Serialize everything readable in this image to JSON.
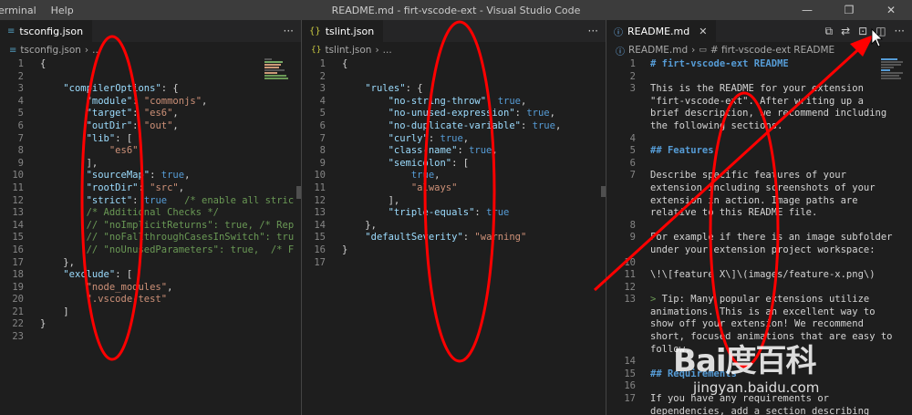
{
  "window": {
    "menu": [
      "erminal",
      "Help"
    ],
    "title": "README.md - firt-vscode-ext - Visual Studio Code",
    "controls": [
      "—",
      "❐",
      "✕"
    ]
  },
  "group1": {
    "tab": "tsconfig.json",
    "breadcrumb": [
      "tsconfig.json",
      "..."
    ],
    "more": "···",
    "lines": [
      {
        "n": "1",
        "t": "{"
      },
      {
        "n": "2",
        "t": ""
      },
      {
        "n": "3",
        "t": "    \"compilerOptions\": {"
      },
      {
        "n": "4",
        "t": "        \"module\": \"commonjs\","
      },
      {
        "n": "5",
        "t": "        \"target\": \"es6\","
      },
      {
        "n": "6",
        "t": "        \"outDir\": \"out\","
      },
      {
        "n": "7",
        "t": "        \"lib\": ["
      },
      {
        "n": "8",
        "t": "            \"es6\""
      },
      {
        "n": "9",
        "t": "        ],"
      },
      {
        "n": "10",
        "t": "        \"sourceMap\": true,"
      },
      {
        "n": "11",
        "t": "        \"rootDir\": \"src\","
      },
      {
        "n": "12",
        "t": "        \"strict\": true   /* enable all stric"
      },
      {
        "n": "13",
        "t": "        /* Additional Checks */"
      },
      {
        "n": "14",
        "t": "        // \"noImplicitReturns\": true, /* Rep"
      },
      {
        "n": "15",
        "t": "        // \"noFallthroughCasesInSwitch\": tru"
      },
      {
        "n": "16",
        "t": "        // \"noUnusedParameters\": true,  /* F"
      },
      {
        "n": "17",
        "t": "    },"
      },
      {
        "n": "18",
        "t": "    \"exclude\": ["
      },
      {
        "n": "19",
        "t": "        \"node_modules\","
      },
      {
        "n": "20",
        "t": "        \".vscode-test\""
      },
      {
        "n": "21",
        "t": "    ]"
      },
      {
        "n": "22",
        "t": "}"
      },
      {
        "n": "23",
        "t": ""
      }
    ]
  },
  "group2": {
    "tab": "tslint.json",
    "breadcrumb": [
      "tslint.json",
      "..."
    ],
    "more": "···",
    "lines": [
      {
        "n": "1",
        "t": "{"
      },
      {
        "n": "2",
        "t": ""
      },
      {
        "n": "3",
        "t": "    \"rules\": {"
      },
      {
        "n": "4",
        "t": "        \"no-string-throw\": true,"
      },
      {
        "n": "5",
        "t": "        \"no-unused-expression\": true,"
      },
      {
        "n": "6",
        "t": "        \"no-duplicate-variable\": true,"
      },
      {
        "n": "7",
        "t": "        \"curly\": true,"
      },
      {
        "n": "8",
        "t": "        \"class-name\": true,"
      },
      {
        "n": "9",
        "t": "        \"semicolon\": ["
      },
      {
        "n": "10",
        "t": "            true,"
      },
      {
        "n": "11",
        "t": "            \"always\""
      },
      {
        "n": "12",
        "t": "        ],"
      },
      {
        "n": "13",
        "t": "        \"triple-equals\": true"
      },
      {
        "n": "14",
        "t": "    },"
      },
      {
        "n": "15",
        "t": "    \"defaultSeverity\": \"warning\""
      },
      {
        "n": "16",
        "t": "}"
      },
      {
        "n": "17",
        "t": ""
      }
    ]
  },
  "group3": {
    "tab": "README.md",
    "breadcrumb": [
      "README.md",
      "# firt-vscode-ext README"
    ],
    "more": "···",
    "lines": [
      {
        "n": "1",
        "t": "# firt-vscode-ext README",
        "k": "h"
      },
      {
        "n": "2",
        "t": "",
        "k": "t"
      },
      {
        "n": "3",
        "t": "This is the README for your extension",
        "k": "t"
      },
      {
        "n": "",
        "t": "\"firt-vscode-ext\". After writing up a",
        "k": "t"
      },
      {
        "n": "",
        "t": "brief description, we recommend including",
        "k": "t"
      },
      {
        "n": "",
        "t": "the following sections.",
        "k": "t"
      },
      {
        "n": "4",
        "t": "",
        "k": "t"
      },
      {
        "n": "5",
        "t": "## Features",
        "k": "h"
      },
      {
        "n": "6",
        "t": "",
        "k": "t"
      },
      {
        "n": "7",
        "t": "Describe specific features of your",
        "k": "t"
      },
      {
        "n": "",
        "t": "extension including screenshots of your",
        "k": "t"
      },
      {
        "n": "",
        "t": "extension in action. Image paths are",
        "k": "t"
      },
      {
        "n": "",
        "t": "relative to this README file.",
        "k": "t"
      },
      {
        "n": "8",
        "t": "",
        "k": "t"
      },
      {
        "n": "9",
        "t": "For example if there is an image subfolder",
        "k": "t"
      },
      {
        "n": "",
        "t": "under your extension project workspace:",
        "k": "t"
      },
      {
        "n": "10",
        "t": "",
        "k": "t"
      },
      {
        "n": "11",
        "t": "\\!\\[feature X\\]\\(images/feature-x.png\\)",
        "k": "t"
      },
      {
        "n": "12",
        "t": "",
        "k": "t"
      },
      {
        "n": "13",
        "t": "> Tip: Many popular extensions utilize",
        "k": "q"
      },
      {
        "n": "",
        "t": "animations. This is an excellent way to",
        "k": "t"
      },
      {
        "n": "",
        "t": "show off your extension! We recommend",
        "k": "t"
      },
      {
        "n": "",
        "t": "short, focused animations that are easy to",
        "k": "t"
      },
      {
        "n": "",
        "t": "follow.",
        "k": "t"
      },
      {
        "n": "14",
        "t": "",
        "k": "t"
      },
      {
        "n": "15",
        "t": "## Requirements",
        "k": "h"
      },
      {
        "n": "16",
        "t": "",
        "k": "t"
      },
      {
        "n": "17",
        "t": "If you have any requirements or",
        "k": "t"
      },
      {
        "n": "",
        "t": "dependencies, add a section describing",
        "k": "t"
      }
    ]
  },
  "watermark": {
    "logo": "Bai度百科",
    "url": "jingyan.baidu.com"
  },
  "colors": {
    "annotation": "#ff0000",
    "keyword": "#9cdcfe",
    "string": "#ce9178",
    "boolean": "#569cd6",
    "comment": "#6a9955"
  }
}
